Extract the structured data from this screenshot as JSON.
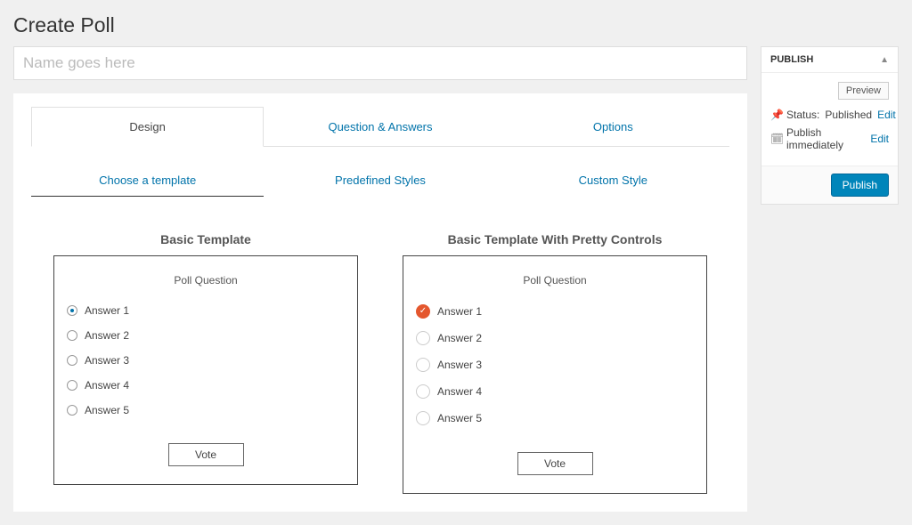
{
  "page_title": "Create Poll",
  "name_input": {
    "value": "",
    "placeholder": "Name goes here"
  },
  "tabs": {
    "design": "Design",
    "qa": "Question & Answers",
    "options": "Options"
  },
  "subtabs": {
    "choose": "Choose a template",
    "predefined": "Predefined Styles",
    "custom": "Custom Style"
  },
  "templates": {
    "basic": {
      "title": "Basic Template",
      "question": "Poll Question",
      "answers": [
        "Answer 1",
        "Answer 2",
        "Answer 3",
        "Answer 4",
        "Answer 5"
      ],
      "vote_label": "Vote"
    },
    "pretty": {
      "title": "Basic Template With Pretty Controls",
      "question": "Poll Question",
      "answers": [
        "Answer 1",
        "Answer 2",
        "Answer 3",
        "Answer 4",
        "Answer 5"
      ],
      "vote_label": "Vote"
    }
  },
  "sidebar": {
    "publish_header": "PUBLISH",
    "preview_label": "Preview",
    "status_label": "Status:",
    "status_value": "Published",
    "edit_label": "Edit",
    "schedule_label": "Publish immediately",
    "publish_btn": "Publish"
  }
}
